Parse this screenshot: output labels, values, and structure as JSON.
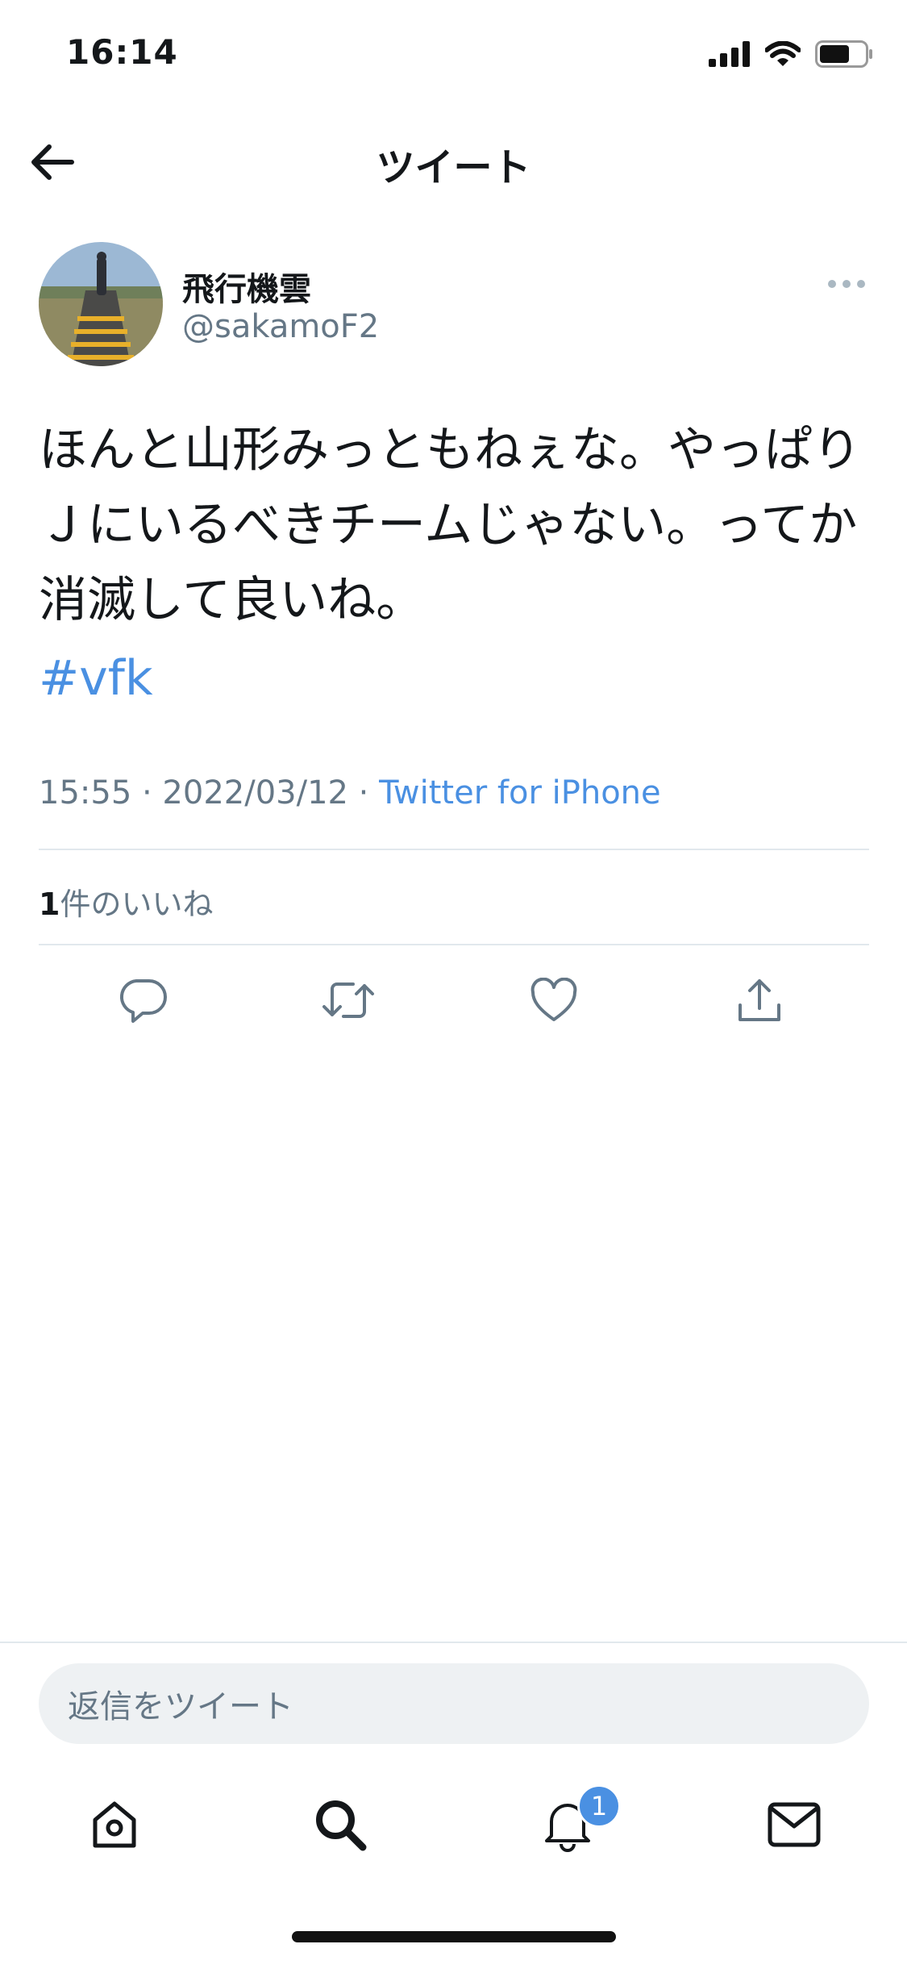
{
  "status_bar": {
    "time": "16:14",
    "icons": [
      "signal-icon",
      "wifi-icon",
      "battery-icon"
    ]
  },
  "header": {
    "title": "ツイート",
    "back_icon": "back-arrow-icon"
  },
  "tweet": {
    "display_name": "飛行機雲",
    "username": "@sakamoF2",
    "text": "ほんと山形みっともねぇな。やっぱりＪにいるべきチームじゃない。ってか消滅して良いね。",
    "hashtag": "#vfk",
    "timestamp": "15:55 · 2022/03/12 · ",
    "source": "Twitter for iPhone",
    "likes_count": "1",
    "likes_label": "件のいいね",
    "more_icon": "more-options-icon"
  },
  "actions": [
    "reply-icon",
    "retweet-icon",
    "like-icon",
    "share-icon"
  ],
  "composer": {
    "placeholder": "返信をツイート"
  },
  "tab_bar": {
    "items": [
      "home-icon",
      "search-icon",
      "notifications-icon",
      "messages-icon"
    ],
    "notification_badge": "1"
  },
  "colors": {
    "accent": "#4a90e2",
    "text_primary": "#14171a",
    "text_secondary": "#657786",
    "divider": "#e1e8ed"
  }
}
